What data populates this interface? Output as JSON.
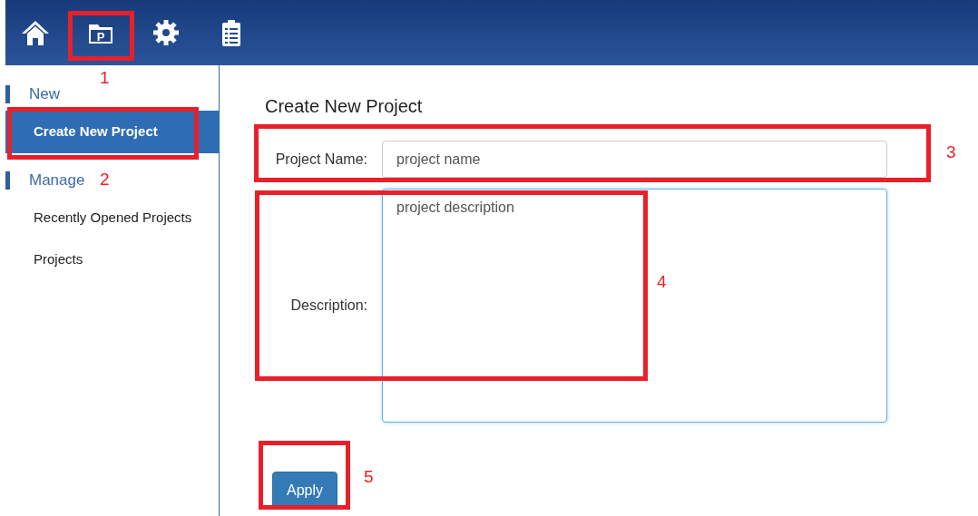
{
  "toolbar": {
    "icons": [
      {
        "kind": "home"
      },
      {
        "kind": "folder",
        "letter": "P"
      },
      {
        "kind": "gear"
      },
      {
        "kind": "clipboard"
      }
    ]
  },
  "sidebar": {
    "sections": [
      {
        "title": "New",
        "items": [
          {
            "label": "Create New Project",
            "selected": true
          }
        ]
      },
      {
        "title": "Manage",
        "items": [
          {
            "label": "Recently Opened Projects",
            "selected": false
          },
          {
            "label": "Projects",
            "selected": false
          }
        ]
      }
    ]
  },
  "form": {
    "title": "Create New Project",
    "fields": [
      {
        "kind": "input",
        "label": "Project Name:",
        "value": "project name",
        "focused": false
      },
      {
        "kind": "textarea",
        "label": "Description:",
        "value": "project description",
        "focused": true
      }
    ],
    "button": "Apply"
  },
  "annotations": [
    {
      "number": "1"
    },
    {
      "number": "2"
    },
    {
      "number": "3"
    },
    {
      "number": "4"
    },
    {
      "number": "5"
    }
  ]
}
